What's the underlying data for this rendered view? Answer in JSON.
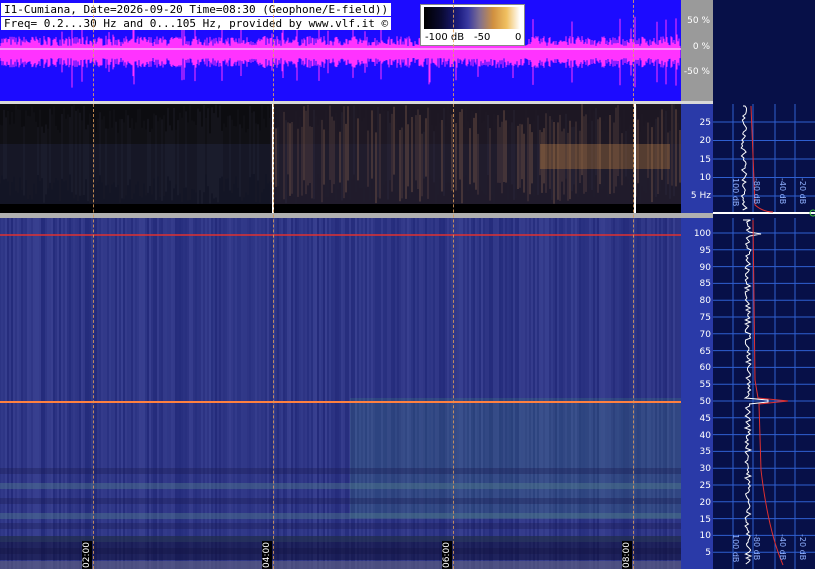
{
  "title": {
    "line1": "I1-Cumiana, Date=2026-09-20 Time=08:30 (Geophone/E-field))",
    "line2": "Freq= 0.2...30 Hz and 0...105 Hz, provided by www.vlf.it ©"
  },
  "colorbar": {
    "labels": [
      "-100 dB",
      "-50",
      "0"
    ]
  },
  "wave_scale": {
    "labels": [
      "50 %",
      "0 %",
      "-50 %"
    ]
  },
  "low_freq_scale": {
    "labels": [
      "25",
      "20",
      "15",
      "10",
      "5 Hz"
    ]
  },
  "high_freq_scale": {
    "labels": [
      "100",
      "95",
      "90",
      "85",
      "80",
      "75",
      "70",
      "65",
      "60",
      "55",
      "50",
      "45",
      "40",
      "35",
      "30",
      "25",
      "20",
      "15",
      "10",
      "5"
    ]
  },
  "time_markers": [
    "02:00",
    "04:00",
    "06:00",
    "08:00"
  ],
  "profile_db_labels": {
    "top": [
      "100 dB",
      "-80 dB",
      "-40 dB",
      "-20 dB"
    ],
    "bottom": [
      "100 dB",
      "-80 dB",
      "-40 dB",
      "-20 dB"
    ]
  },
  "colors": {
    "wave_bg": "#1c0bff",
    "wave_trace": "#ff33ff",
    "line_50hz": "#e03030",
    "profile_trace": "#ffffff",
    "profile_curve": "#e03030"
  }
}
